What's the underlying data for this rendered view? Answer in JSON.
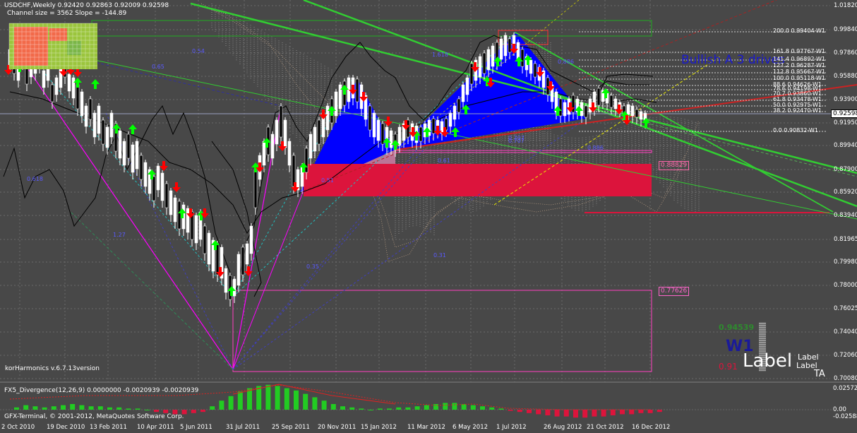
{
  "window": {
    "symbol_line": "USDCHF,Weekly  0.92420 0.92863 0.92009 0.92598",
    "channel_line": "Channel size = 3562 Slope = -144.89",
    "indicator_version": "korHarmonics v.6.7.13version",
    "copyright": "GFX-Terminal, © 2001-2012, MetaQuotes Software Corp.",
    "pattern_label": "Bullish A 3 drives",
    "timeframe_badge": "W1",
    "label_big": "Label",
    "label_small": "Label",
    "label_small2": "Label",
    "tf_letters": "TA",
    "badge_value_top": "0.94539",
    "badge_value_bottom": "0.91"
  },
  "price_axis": {
    "labels": [
      "1.01820",
      "0.99840",
      "0.97860",
      "0.95880",
      "0.93900",
      "0.91950",
      "0.89940",
      "0.87900",
      "0.85920",
      "0.83940",
      "0.81965",
      "0.79980",
      "0.78000",
      "0.76025",
      "0.74040",
      "0.72060",
      "0.70080"
    ],
    "current_price": "0.92598"
  },
  "time_axis": {
    "labels": [
      "2 Oct 2010",
      "19 Dec 2010",
      "13 Feb 2011",
      "10 Apr 2011",
      "5 Jun 2011",
      "31 Jul 2011",
      "25 Sep 2011",
      "20 Nov 2011",
      "15 Jan 2012",
      "11 Mar 2012",
      "6 May 2012",
      "1 Jul 2012",
      "26 Aug 2012",
      "21 Oct 2012",
      "16 Dec 2012"
    ]
  },
  "fib_levels": [
    {
      "label": "200.0  0.99404-W1"
    },
    {
      "label": "161.8  0.97767-W1"
    },
    {
      "label": "141.4  0.96892-W1"
    },
    {
      "label": "127.2  0.96287-W1"
    },
    {
      "label": "112.8  0.95667-W1"
    },
    {
      "label": "100.0  0.95118-W1"
    },
    {
      "label": "88.6  0.94626-W1"
    },
    {
      "label": "78.6  0.94198-W1"
    },
    {
      "label": "70.7  0.93860-W1"
    },
    {
      "label": "61.8  0.93478-W1"
    },
    {
      "label": "50.0  0.92975-W1"
    },
    {
      "label": "38.2  0.92470-W1"
    },
    {
      "label": "0.0  0.90832-W1"
    }
  ],
  "pattern_ratios": [
    "0.618",
    "1.27",
    "0.65",
    "0.54",
    "0.35",
    "0.31",
    "0.51",
    "0.61",
    "0.707",
    "0.707",
    "0.886",
    "1.618",
    "0.886"
  ],
  "box_labels": {
    "target_low": "0.77626",
    "target_mid": "0.88829"
  },
  "macd": {
    "title": "FX5_Divergence(12,26,9) 0.0000000 -0.0020939 -0.0020939",
    "axis_labels": [
      "0.02572",
      "0.00",
      "-0.02588"
    ],
    "values": [
      0.002,
      0.004,
      0.003,
      0.002,
      0.003,
      0.004,
      0.005,
      0.004,
      0.003,
      0.003,
      0.002,
      0.002,
      0.001,
      0.001,
      0.0,
      -0.002,
      -0.003,
      -0.004,
      -0.004,
      -0.003,
      -0.002,
      0.003,
      0.008,
      0.012,
      0.016,
      0.019,
      0.021,
      0.022,
      0.021,
      0.019,
      0.017,
      0.014,
      0.011,
      0.008,
      0.005,
      0.003,
      0.002,
      0.001,
      0.0,
      0.001,
      0.001,
      0.002,
      0.002,
      0.003,
      0.004,
      0.005,
      0.006,
      0.006,
      0.005,
      0.004,
      0.003,
      0.002,
      0.001,
      -0.001,
      -0.002,
      -0.003,
      -0.004,
      -0.005,
      -0.006,
      -0.006,
      -0.007,
      -0.007,
      -0.006,
      -0.006,
      -0.005,
      -0.004,
      -0.004,
      -0.003,
      -0.003,
      -0.002
    ]
  },
  "colors": {
    "background": "#484848",
    "grid": "#6a6a6a",
    "pattern_fill": "#0000ff",
    "zone_red": "#dc143c",
    "bull_arrow": "#00ff00",
    "bear_arrow": "#ff0000",
    "trend_green": "#32cd32",
    "magenta": "#ff00ff",
    "axis_text": "#ffffff"
  }
}
